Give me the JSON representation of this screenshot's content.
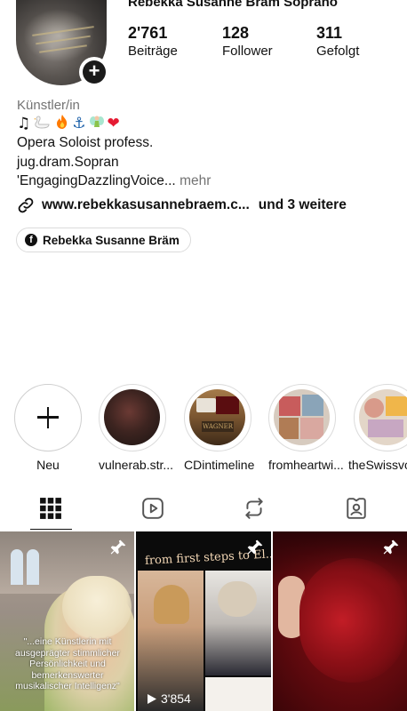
{
  "profile": {
    "username": "Rebekka Susanne Bräm Soprano",
    "stats": [
      {
        "value": "2'761",
        "label": "Beiträge"
      },
      {
        "value": "128",
        "label": "Follower"
      },
      {
        "value": "311",
        "label": "Gefolgt"
      }
    ],
    "category": "Künstler/in",
    "emoji_icons": [
      "music-notes",
      "swan",
      "fire",
      "anchor",
      "fairy",
      "red-heart"
    ],
    "bio_line1": "Opera Soloist profess.",
    "bio_line2": "jug.dram.Sopran",
    "bio_line3": "'EngagingDazzlingVoice...",
    "more_label": "mehr",
    "link_url": "www.rebekkasusannebraem.c...",
    "link_extra": "und 3 weitere",
    "facebook_chip": "Rebekka Susanne Bräm"
  },
  "highlights": [
    {
      "label": "Neu",
      "icon": "plus-icon"
    },
    {
      "label": "vulnerab.str..."
    },
    {
      "label": "CDintimeline"
    },
    {
      "label": "fromheartwi..."
    },
    {
      "label": "theSwissvo"
    }
  ],
  "tabs": [
    {
      "name": "grid",
      "icon": "grid-icon",
      "active": true
    },
    {
      "name": "reels",
      "icon": "reels-icon",
      "active": false
    },
    {
      "name": "reposts",
      "icon": "repost-icon",
      "active": false
    },
    {
      "name": "tagged",
      "icon": "tagged-icon",
      "active": false
    }
  ],
  "posts": [
    {
      "caption": "\"...eine Künstlerin mit ausgeprägter stimmlicher Persönlichkeit und bemerkenswerter musikalischer Intelligenz\"",
      "pinned": true
    },
    {
      "title": "from first steps to El...",
      "views": "3'854",
      "pinned": true
    },
    {
      "pinned": true
    }
  ],
  "colors": {
    "text": "#111111",
    "muted": "#737373",
    "border": "#dbdbdb"
  }
}
